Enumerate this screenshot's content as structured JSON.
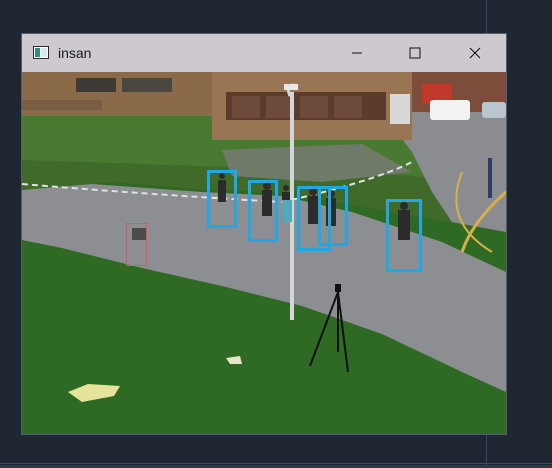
{
  "window": {
    "title": "insan",
    "app_icon": "opencv-window-icon",
    "controls": {
      "minimize": "minimize-icon",
      "maximize": "maximize-icon",
      "close": "close-icon"
    }
  },
  "video_frame": {
    "description_icon": "camera-feed",
    "detections": [
      {
        "label": "person",
        "color": "#1fa8e8"
      },
      {
        "label": "person",
        "color": "#1fa8e8"
      },
      {
        "label": "person",
        "color": "#1fa8e8"
      },
      {
        "label": "person",
        "color": "#1fa8e8"
      },
      {
        "label": "person",
        "color": "#1fa8e8"
      },
      {
        "label": "person",
        "color": "#1fa8e8"
      },
      {
        "label": "object",
        "color": "#e05555"
      }
    ]
  }
}
